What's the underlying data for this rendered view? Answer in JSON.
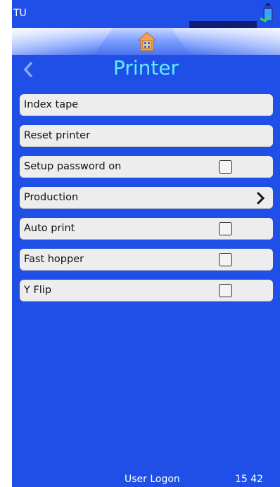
{
  "status_bar": {
    "device_id": "TU",
    "status_icon": "battery-status-icon"
  },
  "header": {
    "home_icon": "home-icon",
    "back_icon": "chevron-left-icon",
    "title": "Printer"
  },
  "menu": {
    "items": [
      {
        "label": "Index tape",
        "control": "none"
      },
      {
        "label": "Reset printer",
        "control": "none"
      },
      {
        "label": "Setup password on",
        "control": "checkbox",
        "checked": false
      },
      {
        "label": "Production",
        "control": "chevron"
      },
      {
        "label": "Auto print",
        "control": "checkbox",
        "checked": false
      },
      {
        "label": "Fast hopper",
        "control": "checkbox",
        "checked": false
      },
      {
        "label": "Y Flip",
        "control": "checkbox",
        "checked": false
      }
    ]
  },
  "footer": {
    "user_logon": "User Logon",
    "time": "15 42"
  },
  "colors": {
    "background": "#1f4fe6",
    "title": "#61ecff",
    "row": "#ededed"
  }
}
